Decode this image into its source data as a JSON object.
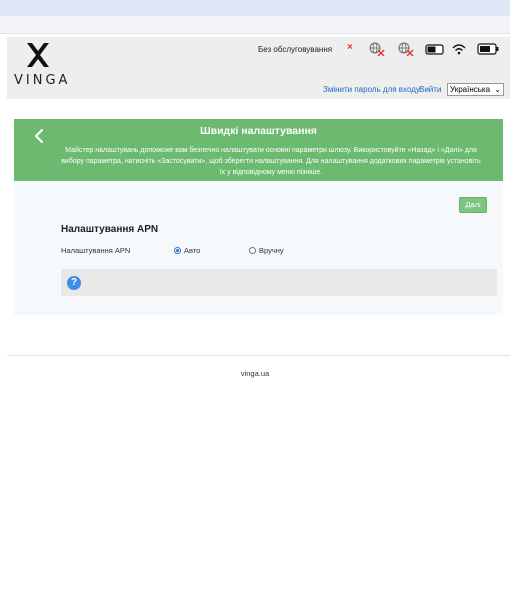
{
  "brand": {
    "name": "VINGA"
  },
  "status": {
    "no_service": "Без обслуговування",
    "icons": [
      "no-sim-icon",
      "internet-disconnected-icon",
      "roaming-disconnected-icon",
      "sms-icon",
      "wifi-icon",
      "battery-icon"
    ]
  },
  "top_links": {
    "change_password": "Змінити пароль для входу",
    "logout": "Вийти",
    "language": "Українська"
  },
  "colors": {
    "banner": "#6cba6f",
    "link": "#2166c0",
    "button": "#7cc57e",
    "help": "#3e8ee8"
  },
  "wizard": {
    "title": "Швидкі налаштування",
    "description": "Майстер налаштувань допоможе вам безпечно налаштувати основні параметри шлюзу. Використовуйте «Назад» і «Далі» для вибору параметра, натисніть «Застосувати», щоб зберегти налаштування. Для налаштування додаткових параметрів установіть їх у відповідному меню пізніше.",
    "next_label": "Далі"
  },
  "apn": {
    "section_title": "Налаштування APN",
    "field_label": "Налаштування APN",
    "options": [
      {
        "label": "Авто",
        "selected": true
      },
      {
        "label": "Вручну",
        "selected": false
      }
    ]
  },
  "footer": {
    "site": "vinga.ua"
  }
}
